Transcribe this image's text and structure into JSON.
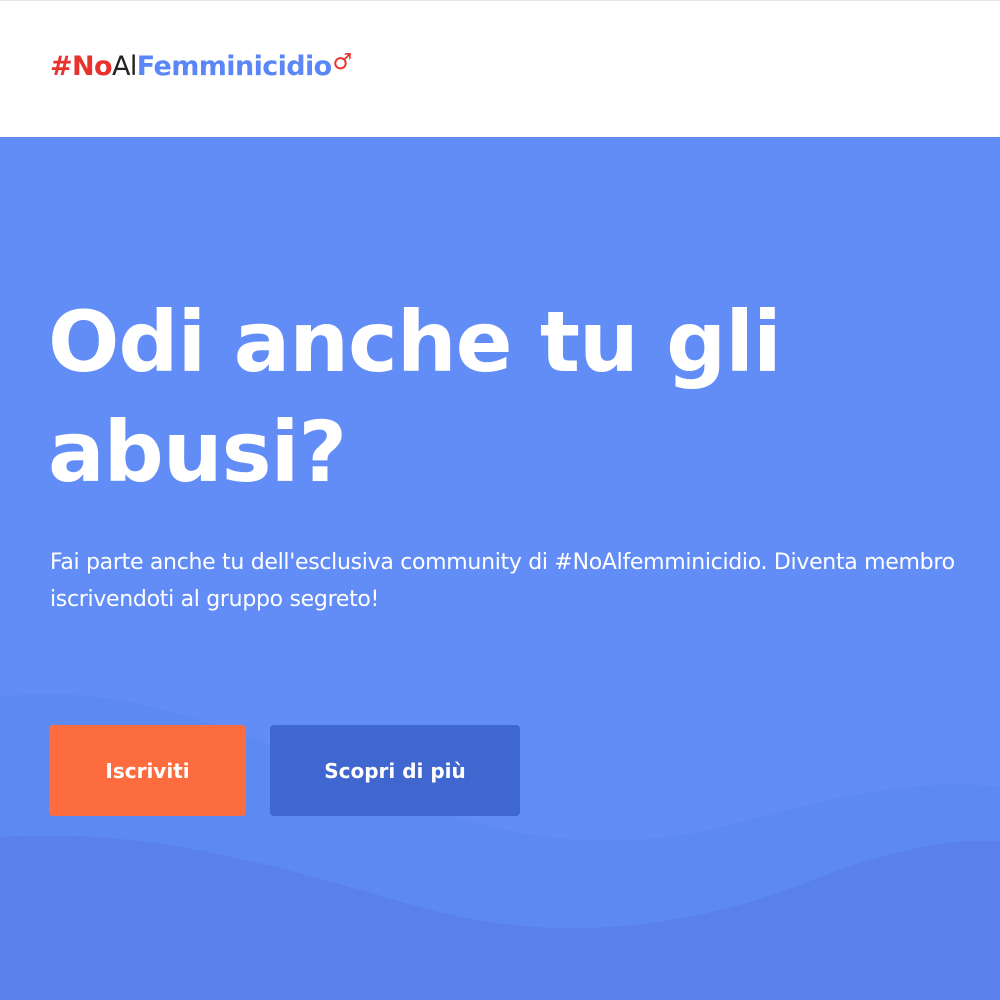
{
  "header": {
    "logo": {
      "part_hash_no": "#No",
      "part_al": "Al",
      "part_femminicidio": "Femminicidio",
      "symbol": "♂"
    }
  },
  "hero": {
    "headline": "Odi anche tu gli abusi?",
    "subtext": "Fai parte anche tu dell'esclusiva community di #NoAlfemminicidio. Diventa membro iscrivendoti al gruppo segreto!",
    "primary_button": "Iscriviti",
    "secondary_button": "Scopri di più"
  },
  "colors": {
    "hero_background": "#628df7",
    "primary_button": "#fd6c3f",
    "secondary_button": "#4066cf",
    "logo_red": "#e8322e",
    "logo_blue": "#5a86f7"
  }
}
